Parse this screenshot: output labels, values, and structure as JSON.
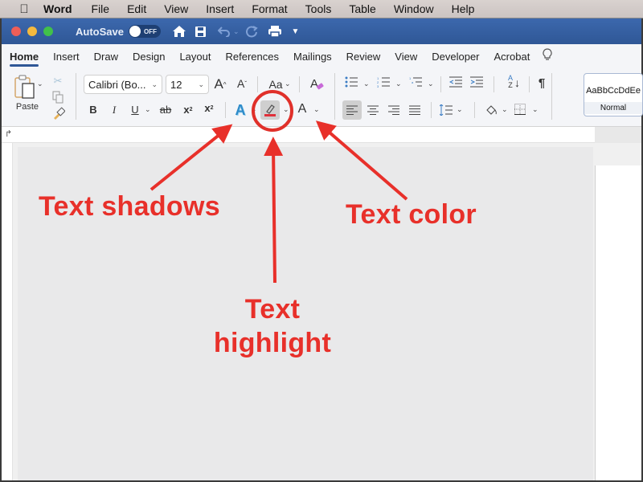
{
  "menubar": {
    "apple_icon": "",
    "app_name": "Word",
    "items": [
      "File",
      "Edit",
      "View",
      "Insert",
      "Format",
      "Tools",
      "Table",
      "Window",
      "Help"
    ]
  },
  "titlebar": {
    "autosave_label": "AutoSave",
    "autosave_state": "OFF",
    "traffic_light_colors": [
      "#ee5e57",
      "#f4b93e",
      "#41c04a"
    ],
    "icons": [
      "home-icon",
      "save-icon",
      "undo-icon",
      "redo-icon",
      "print-icon",
      "customize-toolbar-icon"
    ]
  },
  "ribbon_tabs": {
    "items": [
      "Home",
      "Insert",
      "Draw",
      "Design",
      "Layout",
      "References",
      "Mailings",
      "Review",
      "View",
      "Developer",
      "Acrobat"
    ],
    "active": "Home"
  },
  "ribbon": {
    "paste_label": "Paste",
    "font_name": "Calibri (Bo...",
    "font_size": "12",
    "grow_font": "A",
    "shrink_font": "A",
    "change_case": "Aa",
    "bold": "B",
    "italic": "I",
    "underline": "U",
    "strikethrough": "ab",
    "subscript": "x",
    "superscript": "x",
    "text_effects": "A",
    "font_color": "A",
    "pilcrow": "¶",
    "sort_top": "A",
    "sort_bottom": "Z",
    "style_sample": "AaBbCcDdEe",
    "style_name": "Normal",
    "highlight_color": "#e0303a",
    "accent_color": "#2f5796"
  },
  "annotations": {
    "text_shadows": "Text shadows",
    "text_highlight_line1": "Text",
    "text_highlight_line2": "highlight",
    "text_color": "Text color",
    "color": "#e8302a"
  }
}
